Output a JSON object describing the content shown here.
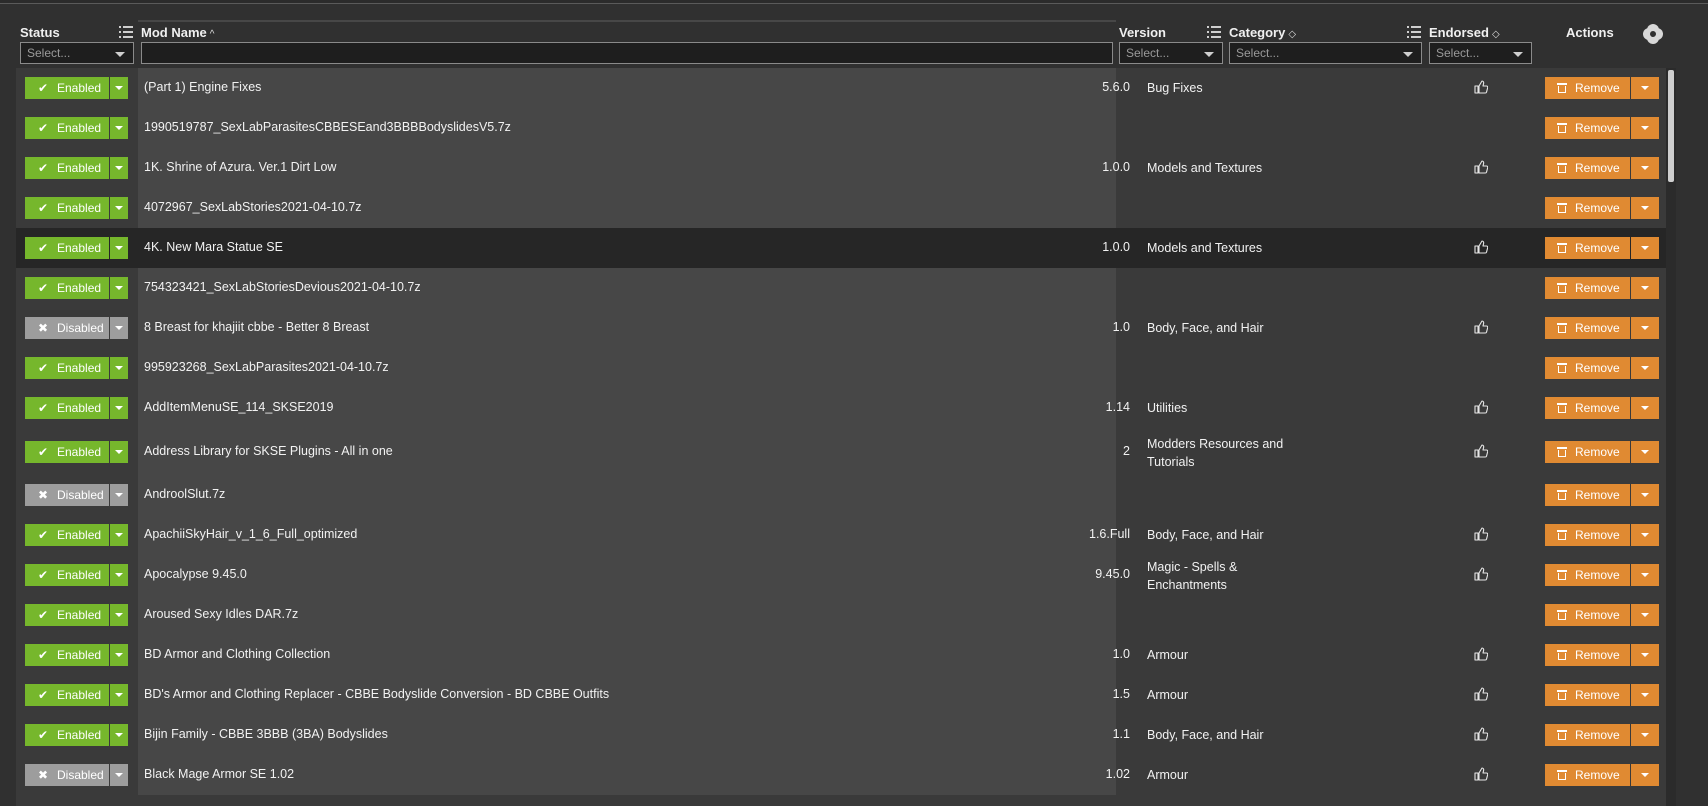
{
  "header": {
    "status": "Status",
    "mod_name": "Mod Name",
    "mod_name_sort": "^",
    "version": "Version",
    "category": "Category",
    "category_sort": "◇",
    "endorsed": "Endorsed",
    "endorsed_sort": "◇",
    "actions": "Actions",
    "select_placeholder": "Select..."
  },
  "labels": {
    "remove": "Remove"
  },
  "colors": {
    "enabled": "#76b72c",
    "disabled": "#9d9d9d",
    "remove": "#e08a32",
    "row_highlight": "#262626"
  },
  "highlighted_row": 4,
  "rows": [
    {
      "status": "Enabled",
      "name": "(Part 1) Engine Fixes",
      "version": "5.6.0",
      "category": "Bug Fixes",
      "endorse": true
    },
    {
      "status": "Enabled",
      "name": "1990519787_SexLabParasitesCBBESEand3BBBBodyslidesV5.7z",
      "version": "",
      "category": "",
      "endorse": false
    },
    {
      "status": "Enabled",
      "name": "1K. Shrine of Azura. Ver.1 Dirt Low",
      "version": "1.0.0",
      "category": "Models and Textures",
      "endorse": true
    },
    {
      "status": "Enabled",
      "name": "4072967_SexLabStories2021-04-10.7z",
      "version": "",
      "category": "",
      "endorse": false
    },
    {
      "status": "Enabled",
      "name": "4K. New Mara Statue SE",
      "version": "1.0.0",
      "category": "Models and Textures",
      "endorse": true
    },
    {
      "status": "Enabled",
      "name": "754323421_SexLabStoriesDevious2021-04-10.7z",
      "version": "",
      "category": "",
      "endorse": false
    },
    {
      "status": "Disabled",
      "name": "8 Breast for khajiit cbbe - Better 8 Breast",
      "version": "1.0",
      "category": "Body, Face, and Hair",
      "endorse": true
    },
    {
      "status": "Enabled",
      "name": "995923268_SexLabParasites2021-04-10.7z",
      "version": "",
      "category": "",
      "endorse": false
    },
    {
      "status": "Enabled",
      "name": "AddItemMenuSE_114_SKSE2019",
      "version": "1.14",
      "category": "Utilities",
      "endorse": true
    },
    {
      "status": "Enabled",
      "name": "Address Library for SKSE Plugins - All in one",
      "version": "2",
      "category": "Modders Resources and Tutorials",
      "endorse": true
    },
    {
      "status": "Disabled",
      "name": "AndroolSlut.7z",
      "version": "",
      "category": "",
      "endorse": false
    },
    {
      "status": "Enabled",
      "name": "ApachiiSkyHair_v_1_6_Full_optimized",
      "version": "1.6.Full",
      "category": "Body, Face, and Hair",
      "endorse": true
    },
    {
      "status": "Enabled",
      "name": "Apocalypse 9.45.0",
      "version": "9.45.0",
      "category": "Magic - Spells & Enchantments",
      "endorse": true
    },
    {
      "status": "Enabled",
      "name": "Aroused Sexy Idles DAR.7z",
      "version": "",
      "category": "",
      "endorse": false
    },
    {
      "status": "Enabled",
      "name": "BD Armor and Clothing Collection",
      "version": "1.0",
      "category": "Armour",
      "endorse": true
    },
    {
      "status": "Enabled",
      "name": "BD's Armor and Clothing Replacer - CBBE Bodyslide Conversion - BD CBBE Outfits",
      "version": "1.5",
      "category": "Armour",
      "endorse": true
    },
    {
      "status": "Enabled",
      "name": "Bijin Family - CBBE 3BBB (3BA) Bodyslides",
      "version": "1.1",
      "category": "Body, Face, and Hair",
      "endorse": true
    },
    {
      "status": "Disabled",
      "name": "Black Mage Armor SE 1.02",
      "version": "1.02",
      "category": "Armour",
      "endorse": true
    }
  ]
}
